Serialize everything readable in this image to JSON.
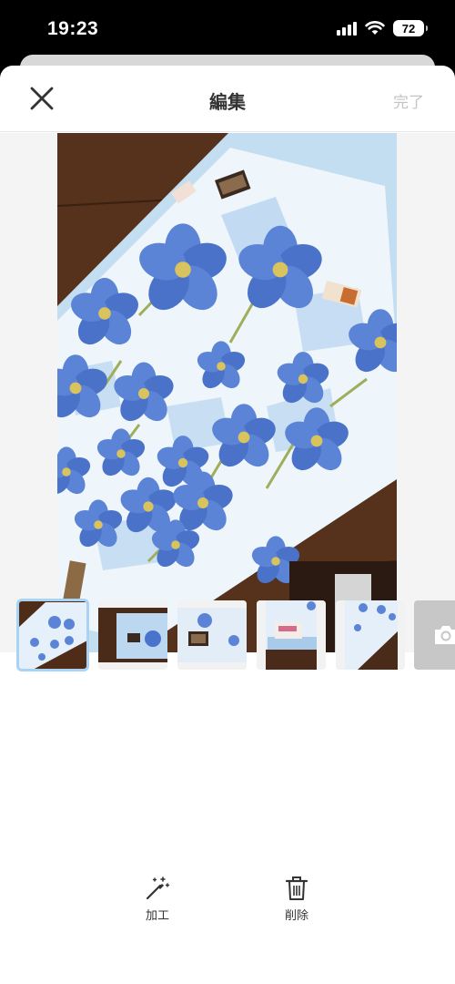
{
  "status_bar": {
    "time": "19:23",
    "battery": "72",
    "signal_icon": "cellular-signal-icon",
    "wifi_icon": "wifi-icon"
  },
  "nav": {
    "title": "編集",
    "done_label": "完了",
    "close_icon": "close-icon"
  },
  "thumbnails": [
    {
      "name": "photo-1",
      "selected": true
    },
    {
      "name": "photo-2",
      "selected": false
    },
    {
      "name": "photo-3",
      "selected": false
    },
    {
      "name": "photo-4",
      "selected": false
    },
    {
      "name": "photo-5",
      "selected": false
    }
  ],
  "add_photo_icon": "camera-icon",
  "tools": {
    "edit": {
      "label": "加工",
      "icon": "magic-wand-icon"
    },
    "delete": {
      "label": "削除",
      "icon": "trash-icon"
    }
  },
  "colors": {
    "selected_outline": "#a9d3f5",
    "done_disabled": "#c4c4c4",
    "blanket_blue": "#4a78d0"
  }
}
